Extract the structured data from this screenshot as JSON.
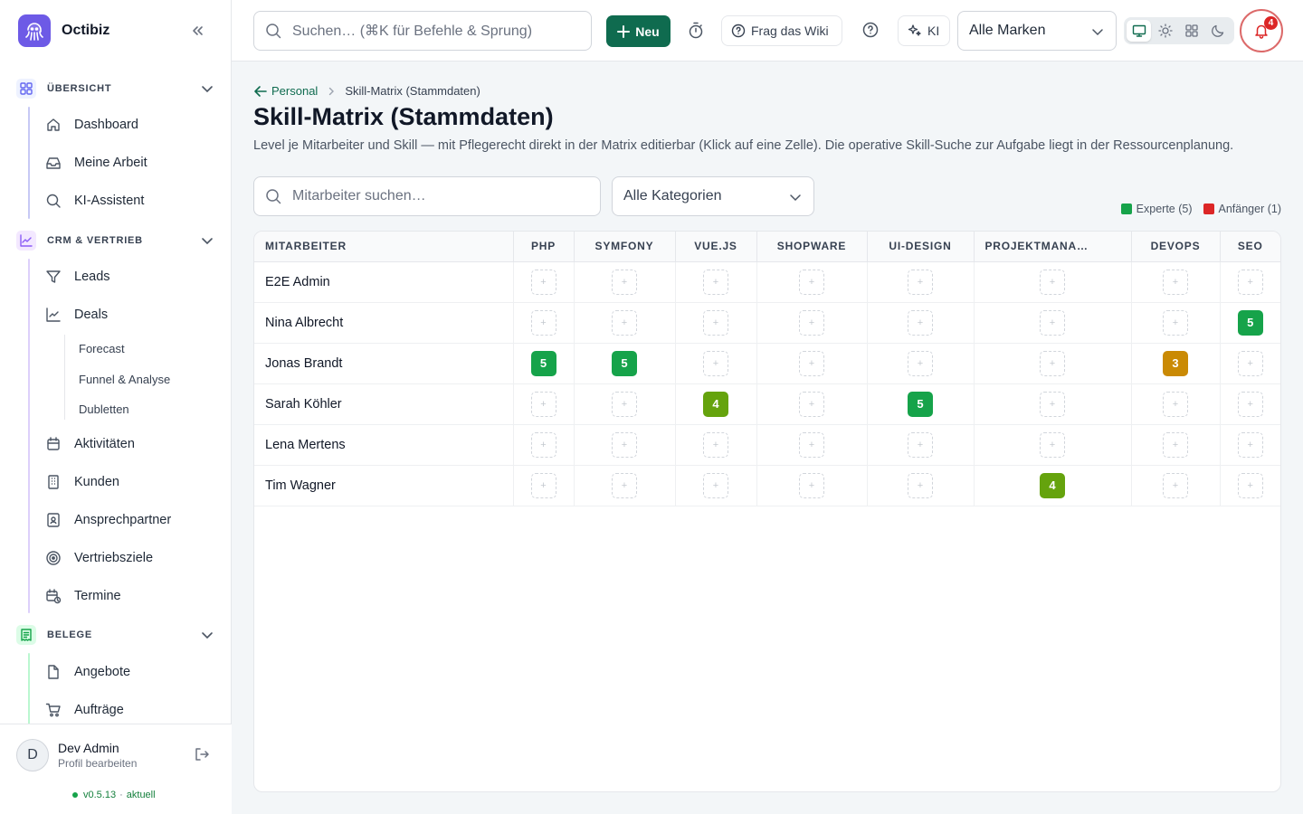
{
  "app": {
    "name": "Octibiz"
  },
  "sidebar": {
    "sections": [
      {
        "label": "ÜBERSICHT",
        "items": [
          "Dashboard",
          "Meine Arbeit",
          "KI-Assistent"
        ]
      },
      {
        "label": "CRM & VERTRIEB",
        "items": [
          "Leads",
          "Deals",
          "Aktivitäten",
          "Kunden",
          "Ansprechpartner",
          "Vertriebsziele",
          "Termine"
        ],
        "deals_sub": [
          "Forecast",
          "Funnel & Analyse",
          "Dubletten"
        ]
      },
      {
        "label": "BELEGE",
        "items": [
          "Angebote",
          "Aufträge"
        ]
      }
    ]
  },
  "user": {
    "name": "Dev Admin",
    "subtitle": "Profil bearbeiten",
    "initial": "D",
    "version": "v0.5.13",
    "version_status": "aktuell"
  },
  "topbar": {
    "search_placeholder": "Suchen… (⌘K für Befehle & Sprung)",
    "new_label": "Neu",
    "wiki_label": "Frag das Wiki",
    "ai_label": "KI",
    "brand_select": "Alle Marken",
    "notification_count": "4"
  },
  "breadcrumb": {
    "parent": "Personal",
    "current": "Skill-Matrix (Stammdaten)"
  },
  "page": {
    "title": "Skill-Matrix (Stammdaten)",
    "description": "Level je Mitarbeiter und Skill — mit Pflegerecht direkt in der Matrix editierbar (Klick auf eine Zelle). Die operative Skill-Suche zur Aufgabe liegt in der Ressourcenplanung."
  },
  "filters": {
    "employee_placeholder": "Mitarbeiter suchen…",
    "category_select": "Alle Kategorien"
  },
  "legend": [
    {
      "label": "Experte (5)",
      "color": "#16a34a"
    },
    {
      "label": "Anfänger (1)",
      "color": "#dc2626"
    }
  ],
  "matrix": {
    "employee_header": "MITARBEITER",
    "skills": [
      "PHP",
      "SYMFONY",
      "VUE.JS",
      "SHOPWARE",
      "UI-DESIGN",
      "PROJEKTMANA…",
      "DEVOPS",
      "SEO"
    ],
    "empty_symbol": "+",
    "level_colors": {
      "3": "#ca8a04",
      "4": "#65a30d",
      "5": "#16a34a"
    },
    "rows": [
      {
        "name": "E2E Admin",
        "levels": [
          null,
          null,
          null,
          null,
          null,
          null,
          null,
          null
        ]
      },
      {
        "name": "Nina Albrecht",
        "levels": [
          null,
          null,
          null,
          null,
          null,
          null,
          null,
          5
        ]
      },
      {
        "name": "Jonas Brandt",
        "levels": [
          5,
          5,
          null,
          null,
          null,
          null,
          3,
          null
        ]
      },
      {
        "name": "Sarah Köhler",
        "levels": [
          null,
          null,
          4,
          null,
          5,
          null,
          null,
          null
        ]
      },
      {
        "name": "Lena Mertens",
        "levels": [
          null,
          null,
          null,
          null,
          null,
          null,
          null,
          null
        ]
      },
      {
        "name": "Tim Wagner",
        "levels": [
          null,
          null,
          null,
          null,
          null,
          4,
          null,
          null
        ]
      }
    ]
  }
}
